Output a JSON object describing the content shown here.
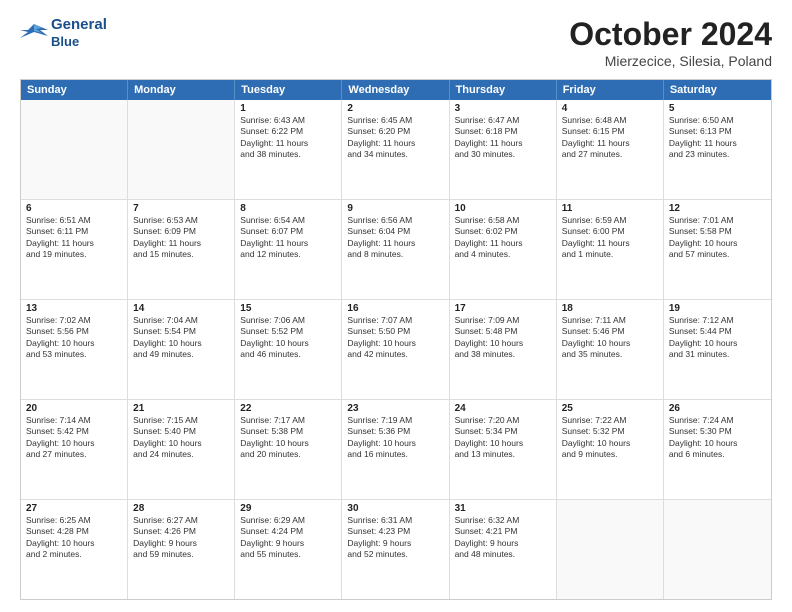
{
  "header": {
    "logo_line1": "General",
    "logo_line2": "Blue",
    "title": "October 2024",
    "subtitle": "Mierzecice, Silesia, Poland"
  },
  "days_of_week": [
    "Sunday",
    "Monday",
    "Tuesday",
    "Wednesday",
    "Thursday",
    "Friday",
    "Saturday"
  ],
  "weeks": [
    [
      {
        "day": "",
        "lines": []
      },
      {
        "day": "",
        "lines": []
      },
      {
        "day": "1",
        "lines": [
          "Sunrise: 6:43 AM",
          "Sunset: 6:22 PM",
          "Daylight: 11 hours",
          "and 38 minutes."
        ]
      },
      {
        "day": "2",
        "lines": [
          "Sunrise: 6:45 AM",
          "Sunset: 6:20 PM",
          "Daylight: 11 hours",
          "and 34 minutes."
        ]
      },
      {
        "day": "3",
        "lines": [
          "Sunrise: 6:47 AM",
          "Sunset: 6:18 PM",
          "Daylight: 11 hours",
          "and 30 minutes."
        ]
      },
      {
        "day": "4",
        "lines": [
          "Sunrise: 6:48 AM",
          "Sunset: 6:15 PM",
          "Daylight: 11 hours",
          "and 27 minutes."
        ]
      },
      {
        "day": "5",
        "lines": [
          "Sunrise: 6:50 AM",
          "Sunset: 6:13 PM",
          "Daylight: 11 hours",
          "and 23 minutes."
        ]
      }
    ],
    [
      {
        "day": "6",
        "lines": [
          "Sunrise: 6:51 AM",
          "Sunset: 6:11 PM",
          "Daylight: 11 hours",
          "and 19 minutes."
        ]
      },
      {
        "day": "7",
        "lines": [
          "Sunrise: 6:53 AM",
          "Sunset: 6:09 PM",
          "Daylight: 11 hours",
          "and 15 minutes."
        ]
      },
      {
        "day": "8",
        "lines": [
          "Sunrise: 6:54 AM",
          "Sunset: 6:07 PM",
          "Daylight: 11 hours",
          "and 12 minutes."
        ]
      },
      {
        "day": "9",
        "lines": [
          "Sunrise: 6:56 AM",
          "Sunset: 6:04 PM",
          "Daylight: 11 hours",
          "and 8 minutes."
        ]
      },
      {
        "day": "10",
        "lines": [
          "Sunrise: 6:58 AM",
          "Sunset: 6:02 PM",
          "Daylight: 11 hours",
          "and 4 minutes."
        ]
      },
      {
        "day": "11",
        "lines": [
          "Sunrise: 6:59 AM",
          "Sunset: 6:00 PM",
          "Daylight: 11 hours",
          "and 1 minute."
        ]
      },
      {
        "day": "12",
        "lines": [
          "Sunrise: 7:01 AM",
          "Sunset: 5:58 PM",
          "Daylight: 10 hours",
          "and 57 minutes."
        ]
      }
    ],
    [
      {
        "day": "13",
        "lines": [
          "Sunrise: 7:02 AM",
          "Sunset: 5:56 PM",
          "Daylight: 10 hours",
          "and 53 minutes."
        ]
      },
      {
        "day": "14",
        "lines": [
          "Sunrise: 7:04 AM",
          "Sunset: 5:54 PM",
          "Daylight: 10 hours",
          "and 49 minutes."
        ]
      },
      {
        "day": "15",
        "lines": [
          "Sunrise: 7:06 AM",
          "Sunset: 5:52 PM",
          "Daylight: 10 hours",
          "and 46 minutes."
        ]
      },
      {
        "day": "16",
        "lines": [
          "Sunrise: 7:07 AM",
          "Sunset: 5:50 PM",
          "Daylight: 10 hours",
          "and 42 minutes."
        ]
      },
      {
        "day": "17",
        "lines": [
          "Sunrise: 7:09 AM",
          "Sunset: 5:48 PM",
          "Daylight: 10 hours",
          "and 38 minutes."
        ]
      },
      {
        "day": "18",
        "lines": [
          "Sunrise: 7:11 AM",
          "Sunset: 5:46 PM",
          "Daylight: 10 hours",
          "and 35 minutes."
        ]
      },
      {
        "day": "19",
        "lines": [
          "Sunrise: 7:12 AM",
          "Sunset: 5:44 PM",
          "Daylight: 10 hours",
          "and 31 minutes."
        ]
      }
    ],
    [
      {
        "day": "20",
        "lines": [
          "Sunrise: 7:14 AM",
          "Sunset: 5:42 PM",
          "Daylight: 10 hours",
          "and 27 minutes."
        ]
      },
      {
        "day": "21",
        "lines": [
          "Sunrise: 7:15 AM",
          "Sunset: 5:40 PM",
          "Daylight: 10 hours",
          "and 24 minutes."
        ]
      },
      {
        "day": "22",
        "lines": [
          "Sunrise: 7:17 AM",
          "Sunset: 5:38 PM",
          "Daylight: 10 hours",
          "and 20 minutes."
        ]
      },
      {
        "day": "23",
        "lines": [
          "Sunrise: 7:19 AM",
          "Sunset: 5:36 PM",
          "Daylight: 10 hours",
          "and 16 minutes."
        ]
      },
      {
        "day": "24",
        "lines": [
          "Sunrise: 7:20 AM",
          "Sunset: 5:34 PM",
          "Daylight: 10 hours",
          "and 13 minutes."
        ]
      },
      {
        "day": "25",
        "lines": [
          "Sunrise: 7:22 AM",
          "Sunset: 5:32 PM",
          "Daylight: 10 hours",
          "and 9 minutes."
        ]
      },
      {
        "day": "26",
        "lines": [
          "Sunrise: 7:24 AM",
          "Sunset: 5:30 PM",
          "Daylight: 10 hours",
          "and 6 minutes."
        ]
      }
    ],
    [
      {
        "day": "27",
        "lines": [
          "Sunrise: 6:25 AM",
          "Sunset: 4:28 PM",
          "Daylight: 10 hours",
          "and 2 minutes."
        ]
      },
      {
        "day": "28",
        "lines": [
          "Sunrise: 6:27 AM",
          "Sunset: 4:26 PM",
          "Daylight: 9 hours",
          "and 59 minutes."
        ]
      },
      {
        "day": "29",
        "lines": [
          "Sunrise: 6:29 AM",
          "Sunset: 4:24 PM",
          "Daylight: 9 hours",
          "and 55 minutes."
        ]
      },
      {
        "day": "30",
        "lines": [
          "Sunrise: 6:31 AM",
          "Sunset: 4:23 PM",
          "Daylight: 9 hours",
          "and 52 minutes."
        ]
      },
      {
        "day": "31",
        "lines": [
          "Sunrise: 6:32 AM",
          "Sunset: 4:21 PM",
          "Daylight: 9 hours",
          "and 48 minutes."
        ]
      },
      {
        "day": "",
        "lines": []
      },
      {
        "day": "",
        "lines": []
      }
    ]
  ]
}
